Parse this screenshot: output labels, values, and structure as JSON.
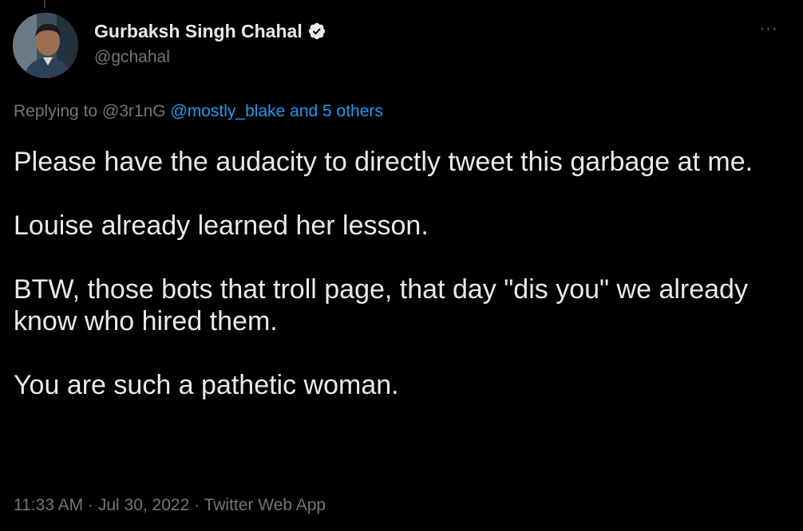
{
  "author": {
    "display_name": "Gurbaksh Singh Chahal",
    "handle": "@gchahal",
    "verified": true,
    "avatar_icon": "profile-photo"
  },
  "menu": {
    "more_icon": "more-horizontal-icon",
    "more_label": "···"
  },
  "reply": {
    "prefix": "Replying to ",
    "first_user": "@3r1nG ",
    "linked_text": "@mostly_blake and 5 others"
  },
  "tweet": {
    "paragraphs": [
      "Please have the audacity to directly tweet this garbage at me.",
      "Louise already learned her lesson.",
      "BTW, those bots that troll page, that day \"dis you\" we already know who hired them.",
      "You are such a pathetic woman."
    ]
  },
  "meta": {
    "time": "11:33 AM",
    "separator": " · ",
    "date": "Jul 30, 2022",
    "source": "Twitter Web App"
  },
  "colors": {
    "background": "#000000",
    "text_primary": "#e7e9ea",
    "text_secondary": "#71767b",
    "link": "#1d9bf0",
    "verified_badge": "#1d9bf0"
  }
}
